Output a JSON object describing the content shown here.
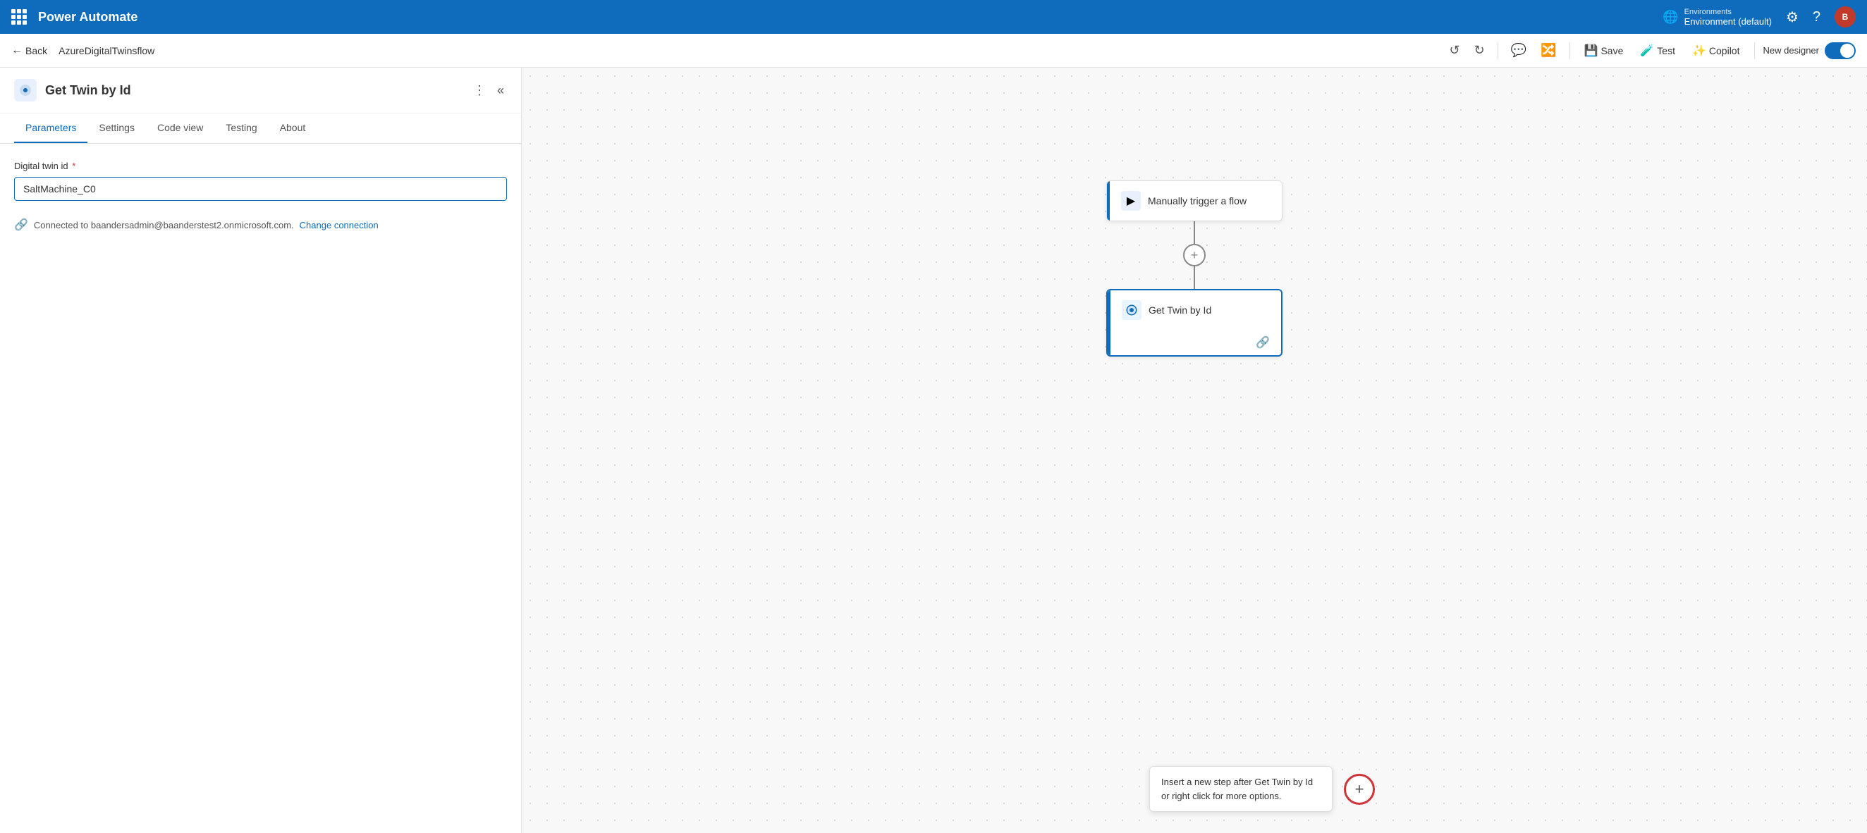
{
  "app": {
    "name": "Power Automate",
    "flow_name": "AzureDigitalTwinsflow"
  },
  "env": {
    "label": "Environments",
    "name": "Environment (default)"
  },
  "toolbar": {
    "back_label": "Back",
    "save_label": "Save",
    "test_label": "Test",
    "copilot_label": "Copilot",
    "new_designer_label": "New designer"
  },
  "panel": {
    "title": "Get Twin by Id",
    "tabs": [
      "Parameters",
      "Settings",
      "Code view",
      "Testing",
      "About"
    ],
    "active_tab": "Parameters"
  },
  "parameters": {
    "field_label": "Digital twin id",
    "field_required": true,
    "field_value": "SaltMachine_C0",
    "connection_text": "Connected to baandersadmin@baanderstest2.onmicrosoft.com.",
    "change_connection_label": "Change connection"
  },
  "canvas": {
    "nodes": [
      {
        "id": "trigger",
        "title": "Manually trigger a flow",
        "icon": "▶"
      },
      {
        "id": "get-twin",
        "title": "Get Twin by Id",
        "icon": "⚙",
        "selected": true
      }
    ],
    "tooltip_text": "Insert a new step after Get Twin by Id or right click for more options.",
    "add_step_label": "+"
  }
}
